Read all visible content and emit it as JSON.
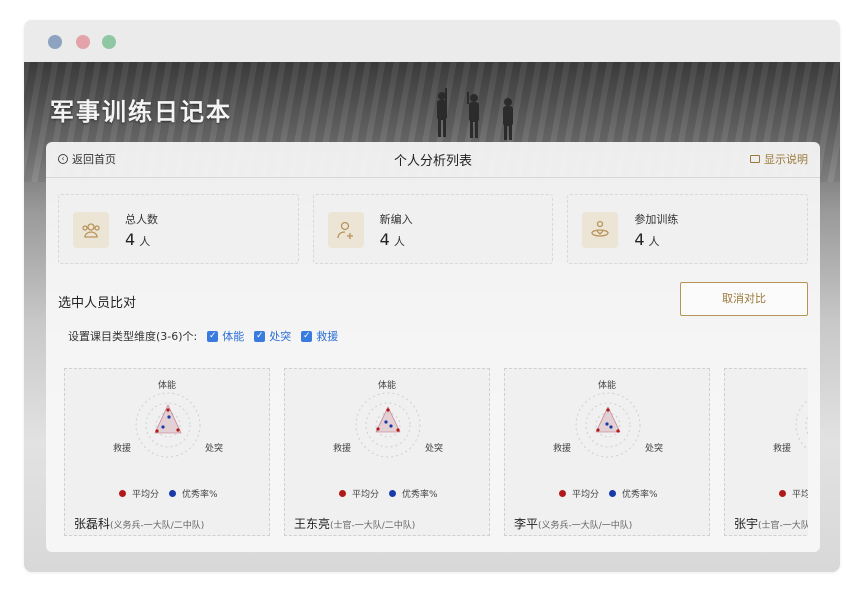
{
  "window": {
    "dots": [
      "#8da3bf",
      "#e3a3a8",
      "#8fc7a3"
    ]
  },
  "app": {
    "title": "军事训练日记本"
  },
  "header": {
    "back_label": "返回首页",
    "title": "个人分析列表",
    "help_label": "显示说明"
  },
  "stats": [
    {
      "label": "总人数",
      "value": "4",
      "unit": "人",
      "icon": "group-icon"
    },
    {
      "label": "新编入",
      "value": "4",
      "unit": "人",
      "icon": "add-user-icon"
    },
    {
      "label": "参加训练",
      "value": "4",
      "unit": "人",
      "icon": "training-icon"
    }
  ],
  "compare": {
    "title": "选中人员比对",
    "cancel_label": "取消对比",
    "dims_label": "设置课目类型维度(3-6)个:",
    "dims": [
      "体能",
      "处突",
      "救援"
    ]
  },
  "legend": {
    "avg": "平均分",
    "excellent": "优秀率%",
    "avg_color": "#b01a1a",
    "excellent_color": "#1a3aa8"
  },
  "persons": [
    {
      "name": "张磊科",
      "meta": "(义务兵-一大队/二中队)"
    },
    {
      "name": "王东亮",
      "meta": "(士官-一大队/二中队)"
    },
    {
      "name": "李平",
      "meta": "(义务兵-一大队/一中队)"
    },
    {
      "name": "张宇",
      "meta": "(士官-一大队"
    }
  ]
}
